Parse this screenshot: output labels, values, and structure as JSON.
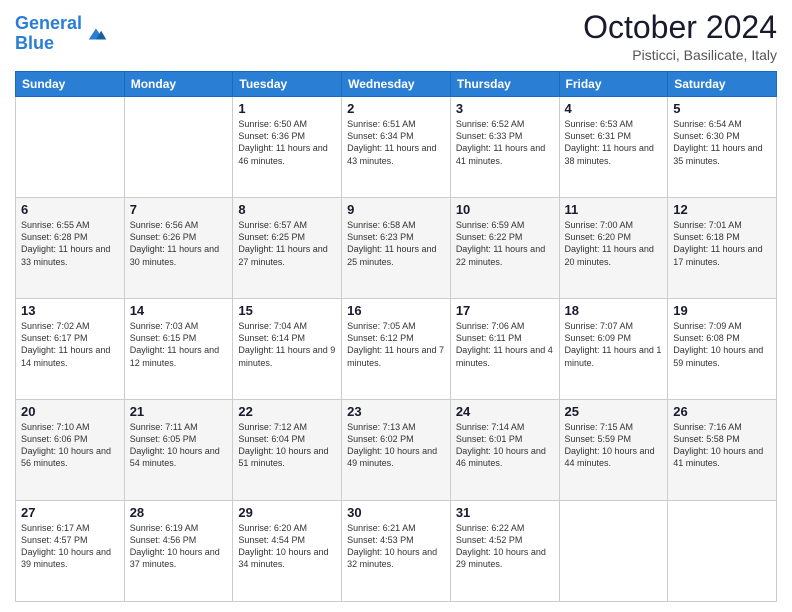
{
  "header": {
    "logo_line1": "General",
    "logo_line2": "Blue",
    "month": "October 2024",
    "location": "Pisticci, Basilicate, Italy"
  },
  "days_of_week": [
    "Sunday",
    "Monday",
    "Tuesday",
    "Wednesday",
    "Thursday",
    "Friday",
    "Saturday"
  ],
  "weeks": [
    [
      {
        "day": "",
        "content": ""
      },
      {
        "day": "",
        "content": ""
      },
      {
        "day": "1",
        "content": "Sunrise: 6:50 AM\nSunset: 6:36 PM\nDaylight: 11 hours and 46 minutes."
      },
      {
        "day": "2",
        "content": "Sunrise: 6:51 AM\nSunset: 6:34 PM\nDaylight: 11 hours and 43 minutes."
      },
      {
        "day": "3",
        "content": "Sunrise: 6:52 AM\nSunset: 6:33 PM\nDaylight: 11 hours and 41 minutes."
      },
      {
        "day": "4",
        "content": "Sunrise: 6:53 AM\nSunset: 6:31 PM\nDaylight: 11 hours and 38 minutes."
      },
      {
        "day": "5",
        "content": "Sunrise: 6:54 AM\nSunset: 6:30 PM\nDaylight: 11 hours and 35 minutes."
      }
    ],
    [
      {
        "day": "6",
        "content": "Sunrise: 6:55 AM\nSunset: 6:28 PM\nDaylight: 11 hours and 33 minutes."
      },
      {
        "day": "7",
        "content": "Sunrise: 6:56 AM\nSunset: 6:26 PM\nDaylight: 11 hours and 30 minutes."
      },
      {
        "day": "8",
        "content": "Sunrise: 6:57 AM\nSunset: 6:25 PM\nDaylight: 11 hours and 27 minutes."
      },
      {
        "day": "9",
        "content": "Sunrise: 6:58 AM\nSunset: 6:23 PM\nDaylight: 11 hours and 25 minutes."
      },
      {
        "day": "10",
        "content": "Sunrise: 6:59 AM\nSunset: 6:22 PM\nDaylight: 11 hours and 22 minutes."
      },
      {
        "day": "11",
        "content": "Sunrise: 7:00 AM\nSunset: 6:20 PM\nDaylight: 11 hours and 20 minutes."
      },
      {
        "day": "12",
        "content": "Sunrise: 7:01 AM\nSunset: 6:18 PM\nDaylight: 11 hours and 17 minutes."
      }
    ],
    [
      {
        "day": "13",
        "content": "Sunrise: 7:02 AM\nSunset: 6:17 PM\nDaylight: 11 hours and 14 minutes."
      },
      {
        "day": "14",
        "content": "Sunrise: 7:03 AM\nSunset: 6:15 PM\nDaylight: 11 hours and 12 minutes."
      },
      {
        "day": "15",
        "content": "Sunrise: 7:04 AM\nSunset: 6:14 PM\nDaylight: 11 hours and 9 minutes."
      },
      {
        "day": "16",
        "content": "Sunrise: 7:05 AM\nSunset: 6:12 PM\nDaylight: 11 hours and 7 minutes."
      },
      {
        "day": "17",
        "content": "Sunrise: 7:06 AM\nSunset: 6:11 PM\nDaylight: 11 hours and 4 minutes."
      },
      {
        "day": "18",
        "content": "Sunrise: 7:07 AM\nSunset: 6:09 PM\nDaylight: 11 hours and 1 minute."
      },
      {
        "day": "19",
        "content": "Sunrise: 7:09 AM\nSunset: 6:08 PM\nDaylight: 10 hours and 59 minutes."
      }
    ],
    [
      {
        "day": "20",
        "content": "Sunrise: 7:10 AM\nSunset: 6:06 PM\nDaylight: 10 hours and 56 minutes."
      },
      {
        "day": "21",
        "content": "Sunrise: 7:11 AM\nSunset: 6:05 PM\nDaylight: 10 hours and 54 minutes."
      },
      {
        "day": "22",
        "content": "Sunrise: 7:12 AM\nSunset: 6:04 PM\nDaylight: 10 hours and 51 minutes."
      },
      {
        "day": "23",
        "content": "Sunrise: 7:13 AM\nSunset: 6:02 PM\nDaylight: 10 hours and 49 minutes."
      },
      {
        "day": "24",
        "content": "Sunrise: 7:14 AM\nSunset: 6:01 PM\nDaylight: 10 hours and 46 minutes."
      },
      {
        "day": "25",
        "content": "Sunrise: 7:15 AM\nSunset: 5:59 PM\nDaylight: 10 hours and 44 minutes."
      },
      {
        "day": "26",
        "content": "Sunrise: 7:16 AM\nSunset: 5:58 PM\nDaylight: 10 hours and 41 minutes."
      }
    ],
    [
      {
        "day": "27",
        "content": "Sunrise: 6:17 AM\nSunset: 4:57 PM\nDaylight: 10 hours and 39 minutes."
      },
      {
        "day": "28",
        "content": "Sunrise: 6:19 AM\nSunset: 4:56 PM\nDaylight: 10 hours and 37 minutes."
      },
      {
        "day": "29",
        "content": "Sunrise: 6:20 AM\nSunset: 4:54 PM\nDaylight: 10 hours and 34 minutes."
      },
      {
        "day": "30",
        "content": "Sunrise: 6:21 AM\nSunset: 4:53 PM\nDaylight: 10 hours and 32 minutes."
      },
      {
        "day": "31",
        "content": "Sunrise: 6:22 AM\nSunset: 4:52 PM\nDaylight: 10 hours and 29 minutes."
      },
      {
        "day": "",
        "content": ""
      },
      {
        "day": "",
        "content": ""
      }
    ]
  ]
}
